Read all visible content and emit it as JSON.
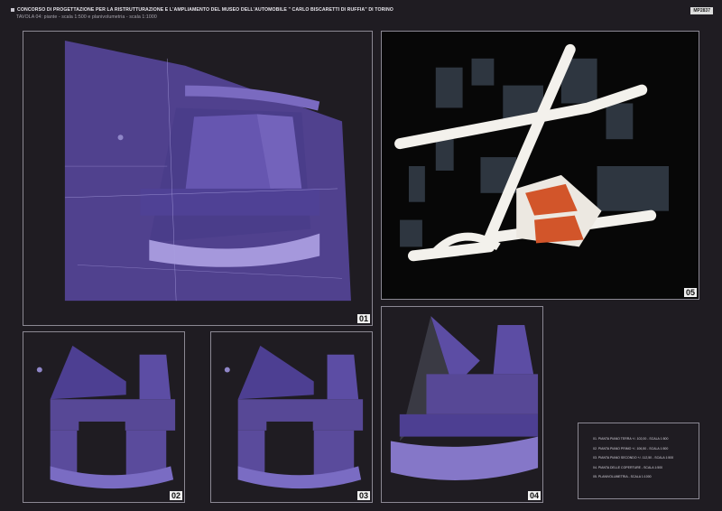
{
  "header": {
    "title": "CONCORSO DI PROGETTAZIONE PER LA RISTRUTTURAZIONE E L'AMPLIAMENTO DEL MUSEO DELL'AUTOMOBILE \" CARLO BISCARETTI DI RUFFIA\" DI TORINO",
    "subtitle": "TAVOLA 04: piante - scala 1:500 e planivolumetria - scala 1:1000",
    "code": "MP2837"
  },
  "panels": [
    {
      "id": "01",
      "label": "01"
    },
    {
      "id": "02",
      "label": "02"
    },
    {
      "id": "03",
      "label": "03"
    },
    {
      "id": "04",
      "label": "04"
    },
    {
      "id": "05",
      "label": "05"
    }
  ],
  "legend": {
    "items": [
      "01. PIANTA PIANO TERRA  +/- 102,00 -  SCALA 1:500",
      "02. PIANTA PIANO PRIMO +/- 106,50 -  SCALA 1:500",
      "03. PIANTA PIANO SECONDO +/- 112,50 -  SCALA 1:500",
      "04. PIANTA DELLE COPERTURE - SCALA 1:500",
      "05. PLANIVOLUMETRIA - SCALA 1:1000"
    ]
  },
  "colors": {
    "background": "#1f1c22",
    "plan_purple": "#5b4a9e",
    "accent_orange": "#d2552a",
    "road_white": "#f3f1ec"
  }
}
